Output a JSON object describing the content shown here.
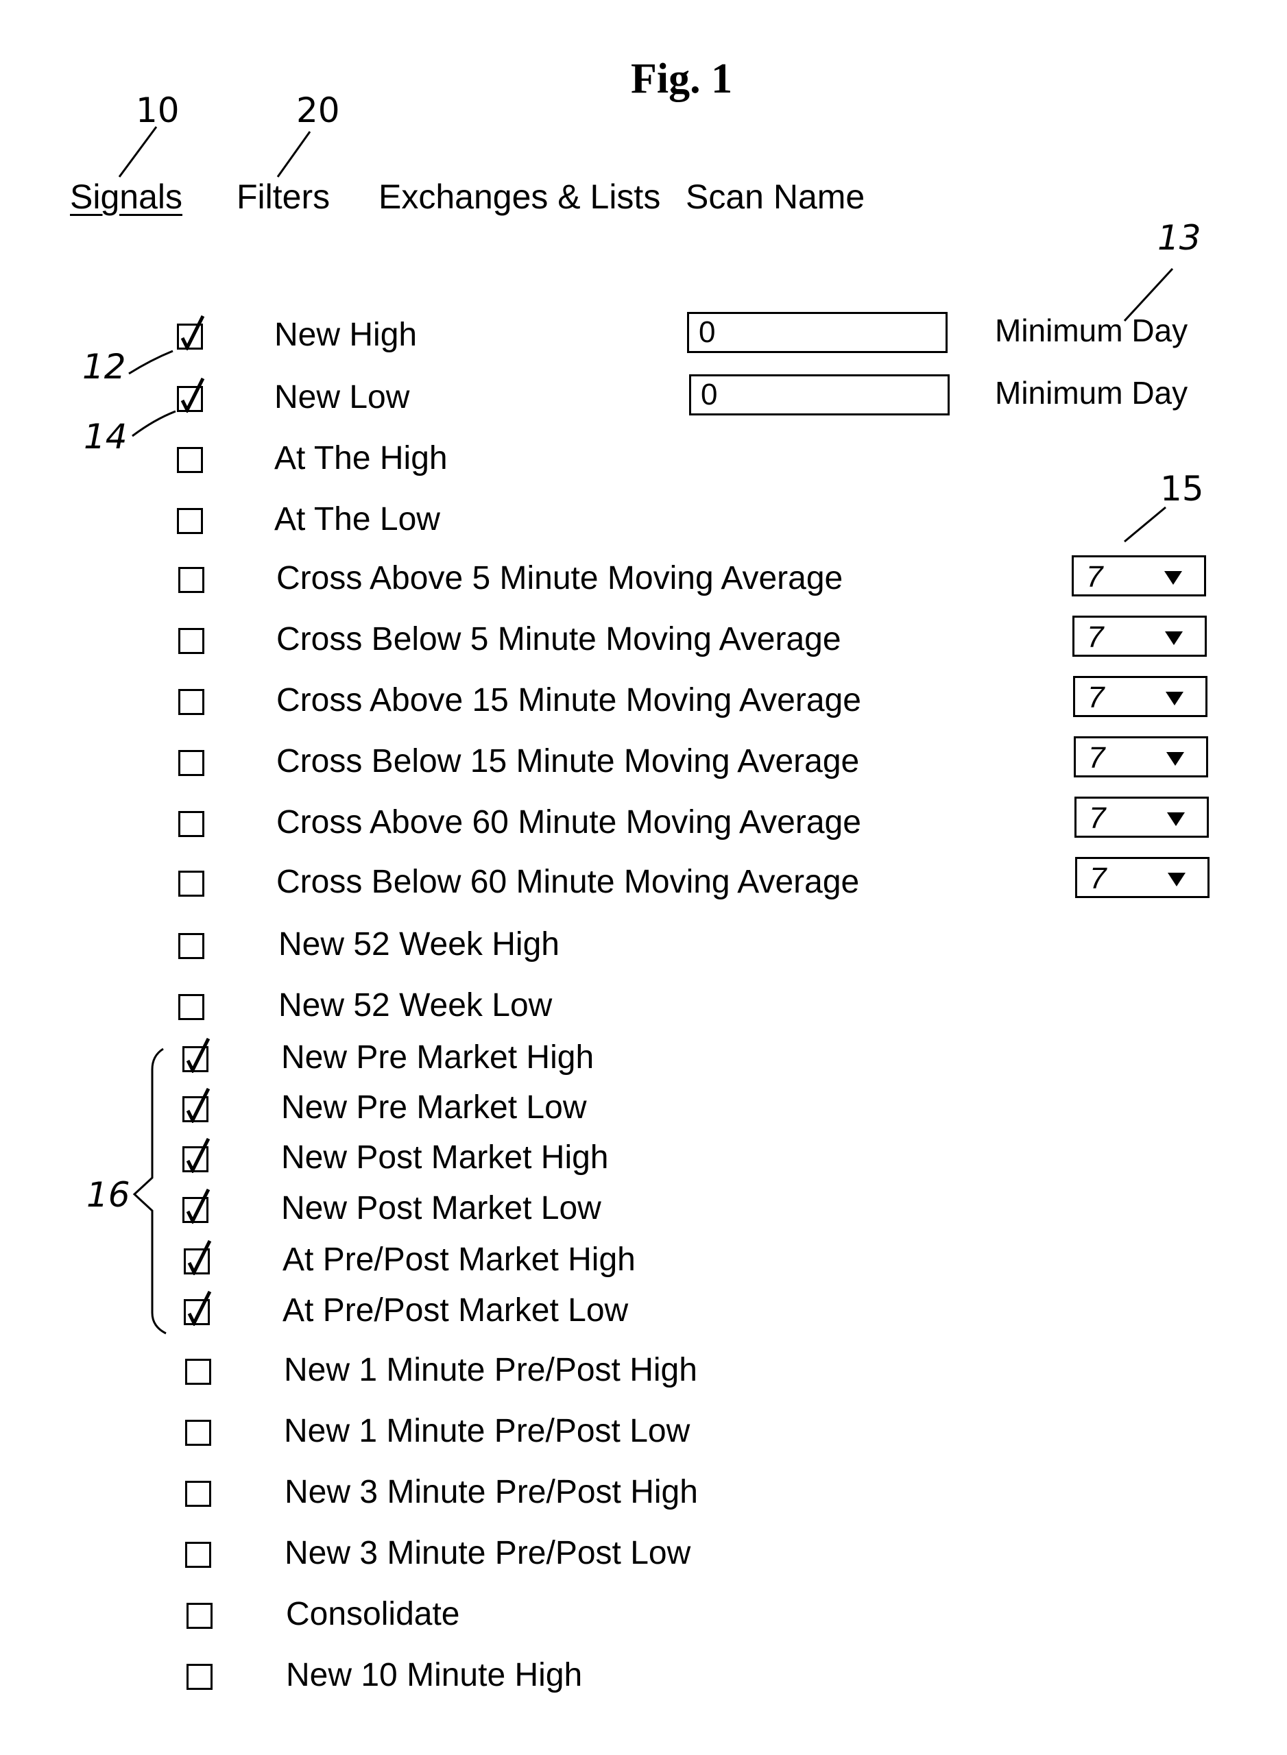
{
  "figure": {
    "title": "Fig. 1"
  },
  "reference_numerals": {
    "signals_tab": "10",
    "filters_tab": "20",
    "new_high_checkbox": "12",
    "new_low_checkbox": "14",
    "minimum_day_field": "13",
    "period_dropdown": "15",
    "pre_post_market_group": "16"
  },
  "tabs": [
    {
      "label": "Signals",
      "active": true
    },
    {
      "label": "Filters",
      "active": false
    },
    {
      "label": "Exchanges & Lists",
      "active": false
    },
    {
      "label": "Scan Name",
      "active": false
    }
  ],
  "signals": [
    {
      "label": "New High",
      "checked": true,
      "input_value": "0",
      "input_label": "Minimum Day"
    },
    {
      "label": "New Low",
      "checked": true,
      "input_value": "0",
      "input_label": "Minimum Day"
    },
    {
      "label": "At The High",
      "checked": false
    },
    {
      "label": "At The Low",
      "checked": false
    },
    {
      "label": "Cross Above 5 Minute Moving Average",
      "checked": false,
      "dropdown_value": "7"
    },
    {
      "label": "Cross Below 5 Minute Moving Average",
      "checked": false,
      "dropdown_value": "7"
    },
    {
      "label": "Cross Above 15 Minute Moving Average",
      "checked": false,
      "dropdown_value": "7"
    },
    {
      "label": "Cross Below 15 Minute Moving Average",
      "checked": false,
      "dropdown_value": "7"
    },
    {
      "label": "Cross Above 60 Minute Moving Average",
      "checked": false,
      "dropdown_value": "7"
    },
    {
      "label": "Cross Below 60 Minute Moving Average",
      "checked": false,
      "dropdown_value": "7"
    },
    {
      "label": "New 52 Week High",
      "checked": false
    },
    {
      "label": "New 52 Week Low",
      "checked": false
    },
    {
      "label": "New Pre Market High",
      "checked": true
    },
    {
      "label": "New Pre Market Low",
      "checked": true
    },
    {
      "label": "New Post Market High",
      "checked": true
    },
    {
      "label": "New Post Market Low",
      "checked": true
    },
    {
      "label": "At Pre/Post Market High",
      "checked": true
    },
    {
      "label": "At Pre/Post Market Low",
      "checked": true
    },
    {
      "label": "New 1 Minute Pre/Post High",
      "checked": false
    },
    {
      "label": "New 1 Minute Pre/Post Low",
      "checked": false
    },
    {
      "label": "New 3 Minute Pre/Post High",
      "checked": false
    },
    {
      "label": "New 3 Minute Pre/Post Low",
      "checked": false
    },
    {
      "label": "Consolidate",
      "checked": false
    },
    {
      "label": "New 10 Minute High",
      "checked": false
    }
  ]
}
